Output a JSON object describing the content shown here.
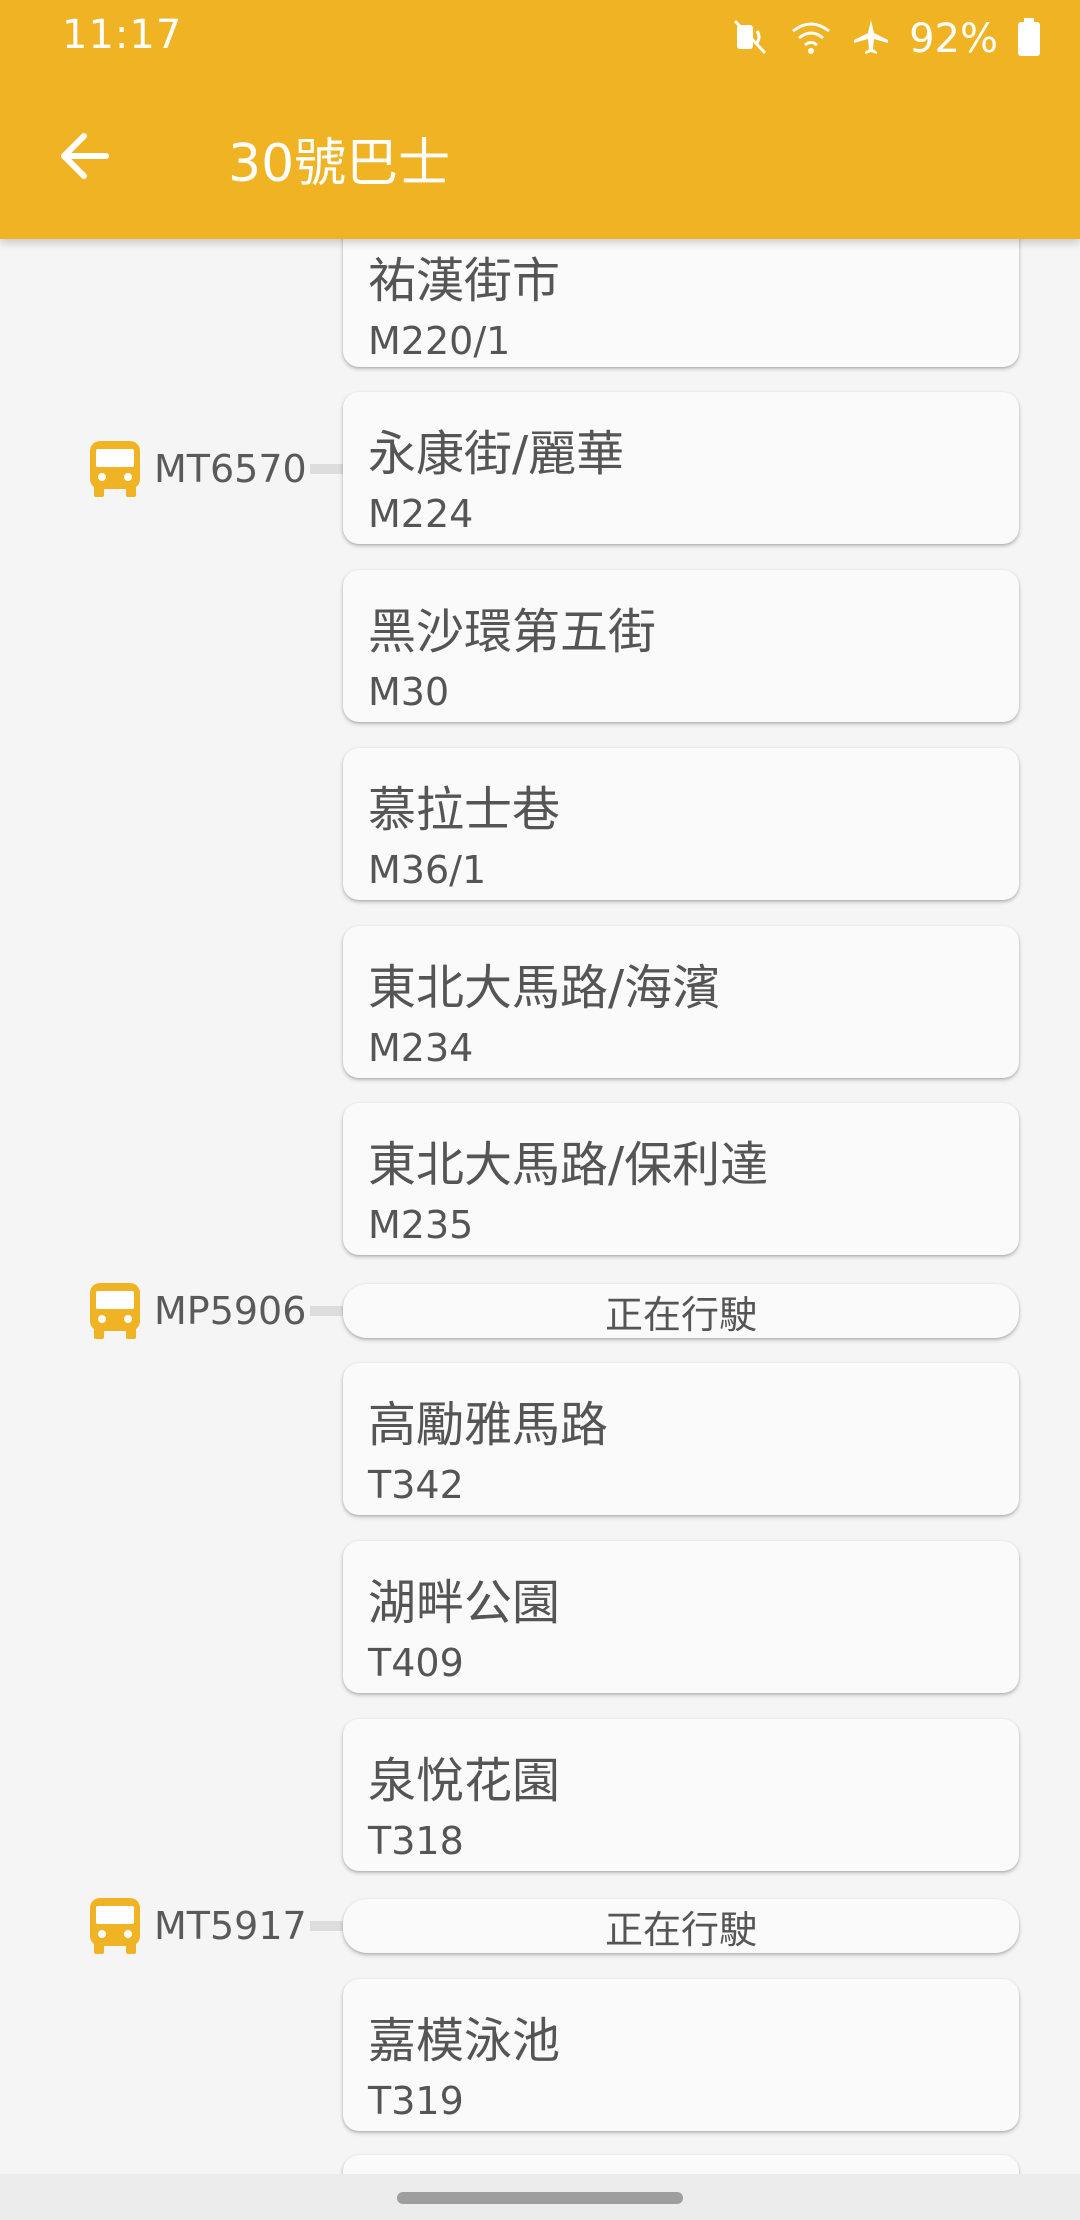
{
  "status_bar": {
    "time": "11:17",
    "battery": "92%",
    "icons": [
      "mute-icon",
      "wifi-icon",
      "airplane-icon",
      "battery-icon"
    ]
  },
  "app_bar": {
    "title": "30號巴士",
    "back_icon": "arrow-back-icon",
    "color": "#F0B323"
  },
  "stops": [
    {
      "name": "祐漢街市",
      "code": "M220/1"
    },
    {
      "name": "永康街/麗華",
      "code": "M224"
    },
    {
      "name": "黑沙環第五街",
      "code": "M30"
    },
    {
      "name": "慕拉士巷",
      "code": "M36/1"
    },
    {
      "name": "東北大馬路/海濱",
      "code": "M234"
    },
    {
      "name": "東北大馬路/保利達",
      "code": "M235"
    },
    {
      "name": "高勵雅馬路",
      "code": "T342"
    },
    {
      "name": "湖畔公園",
      "code": "T409"
    },
    {
      "name": "泉悅花園",
      "code": "T318"
    },
    {
      "name": "嘉模泳池",
      "code": "T319"
    }
  ],
  "moving_status": [
    {
      "label": "正在行駛"
    },
    {
      "label": "正在行駛"
    }
  ],
  "buses": [
    {
      "plate": "MT6570"
    },
    {
      "plate": "MP5906"
    },
    {
      "plate": "MT5917"
    }
  ]
}
